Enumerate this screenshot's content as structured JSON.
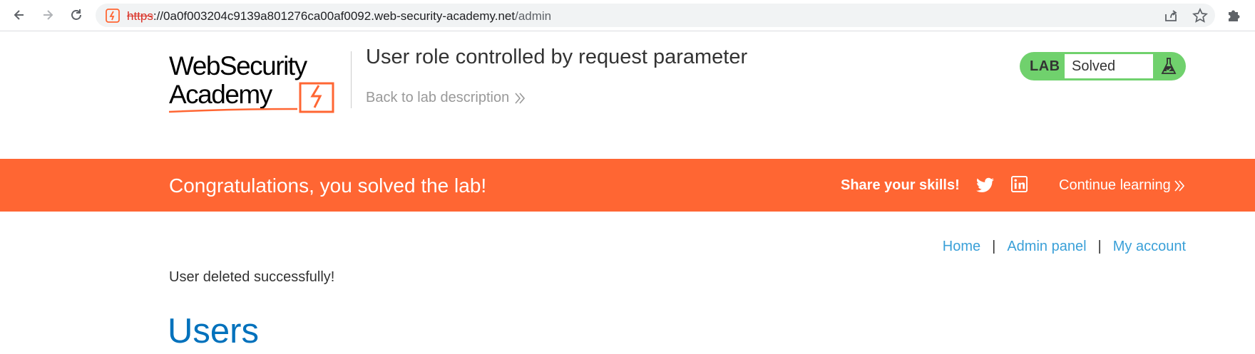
{
  "browser": {
    "url_scheme": "https",
    "url_host": "://0a0f003204c9139a801276ca00af0092.web-security-academy.net",
    "url_path": "/admin"
  },
  "header": {
    "logo_line1": "WebSecurity",
    "logo_line2": "Academy",
    "lab_title": "User role controlled by request parameter",
    "back_link": "Back to lab description"
  },
  "lab_status": {
    "badge": "LAB",
    "status": "Solved",
    "accent_color": "#70d16d"
  },
  "banner": {
    "message": "Congratulations, you solved the lab!",
    "share_label": "Share your skills!",
    "continue_label": "Continue learning",
    "background_color": "#ff6633"
  },
  "nav": {
    "home": "Home",
    "admin_panel": "Admin panel",
    "my_account": "My account",
    "separator": "|"
  },
  "main": {
    "message": "User deleted successfully!",
    "heading": "Users"
  }
}
